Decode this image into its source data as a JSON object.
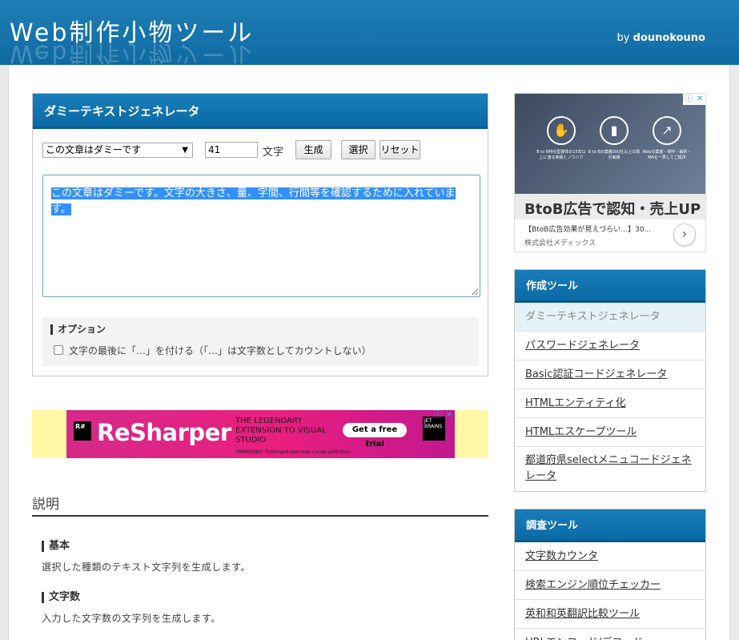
{
  "header": {
    "site_title": "Web制作小物ツール",
    "by_prefix": "by",
    "author": "dounokouno"
  },
  "tool": {
    "title": "ダミーテキストジェネレータ",
    "text_type_selected": "この文章はダミーです",
    "char_count": "41",
    "char_unit": "文字",
    "generate_label": "生成",
    "select_label": "選択",
    "reset_label": "リセット",
    "output_text": "この文章はダミーです。文字の大きさ、量、字間、行間等を確認するために入れています。",
    "options_title": "オプション",
    "option_ellipsis_label": "文字の最後に「…」を付ける（「…」は文字数としてカウントしない）",
    "option_ellipsis_checked": false
  },
  "ad_banner": {
    "logo_mark": "R#",
    "brand": "ReSharper",
    "tagline": "THE LEGENDARY EXTENSION TO VISUAL STUDIO",
    "cta": "Get a free trial",
    "warning": "*WARNING! Prolonged use may cause addiction.",
    "vendor_mark": "JET BRAINS"
  },
  "ad_side": {
    "captions": [
      "B to B特化型媒体の15年以上に渡る実績とノウハウ",
      "B to Bの業種300社以上の取引実績",
      "Webの集客・制作・解析・MAを一貫してご提供"
    ],
    "headline": "BtoB広告で認知・売上UP",
    "subline": "【BtoB広告効果が見えづらい…】30...",
    "advertiser": "株式会社メディックス"
  },
  "nav_create": {
    "title": "作成ツール",
    "items": [
      "ダミーテキストジェネレータ",
      "パスワードジェネレータ",
      "Basic認証コードジェネレータ",
      "HTMLエンティティ化",
      "HTMLエスケープツール",
      "都道府県selectメニュコードジェネレータ"
    ],
    "active_index": 0
  },
  "nav_research": {
    "title": "調査ツール",
    "items": [
      "文字数カウンタ",
      "検索エンジン順位チェッカー",
      "英和和英翻訳比較ツール",
      "URLエンコード/デコード"
    ]
  },
  "description": {
    "title": "説明",
    "sections": [
      {
        "heading": "基本",
        "body": "選択した種類のテキスト文字列を生成します。"
      },
      {
        "heading": "文字数",
        "body": "入力した文字数の文字列を生成します。"
      }
    ]
  },
  "colors": {
    "header_blue": "#1f7fb5",
    "panel_blue": "#0a6aa6",
    "selection_blue": "#3390ff",
    "ad_yellow": "#fff9a6",
    "ad_pink": "#e91e7e"
  }
}
